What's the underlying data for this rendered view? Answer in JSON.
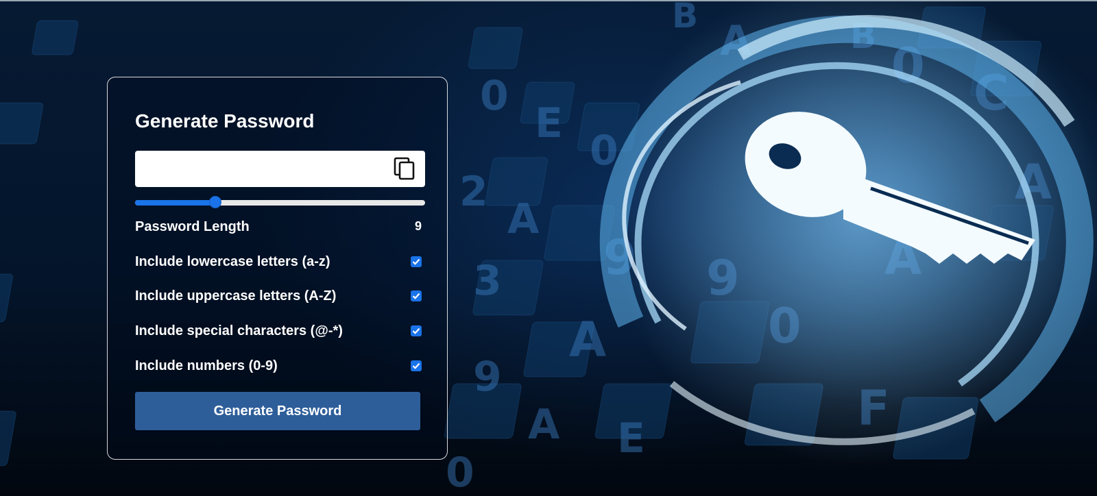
{
  "card": {
    "title": "Generate Password",
    "password_value": "",
    "password_placeholder": "",
    "copy_icon": "copy-icon",
    "length_slider": {
      "min": 1,
      "max": 30,
      "value": 9
    },
    "length_label": "Password Length",
    "length_value": "9",
    "options": [
      {
        "label": "Include lowercase letters (a-z)",
        "checked": true
      },
      {
        "label": "Include uppercase letters (A-Z)",
        "checked": true
      },
      {
        "label": "Include special characters (@-*)",
        "checked": true
      },
      {
        "label": "Include numbers (0-9)",
        "checked": true
      }
    ],
    "generate_label": "Generate Password"
  },
  "colors": {
    "accent": "#1a73e8",
    "button": "#2e5e9a",
    "background": "#04152b"
  }
}
